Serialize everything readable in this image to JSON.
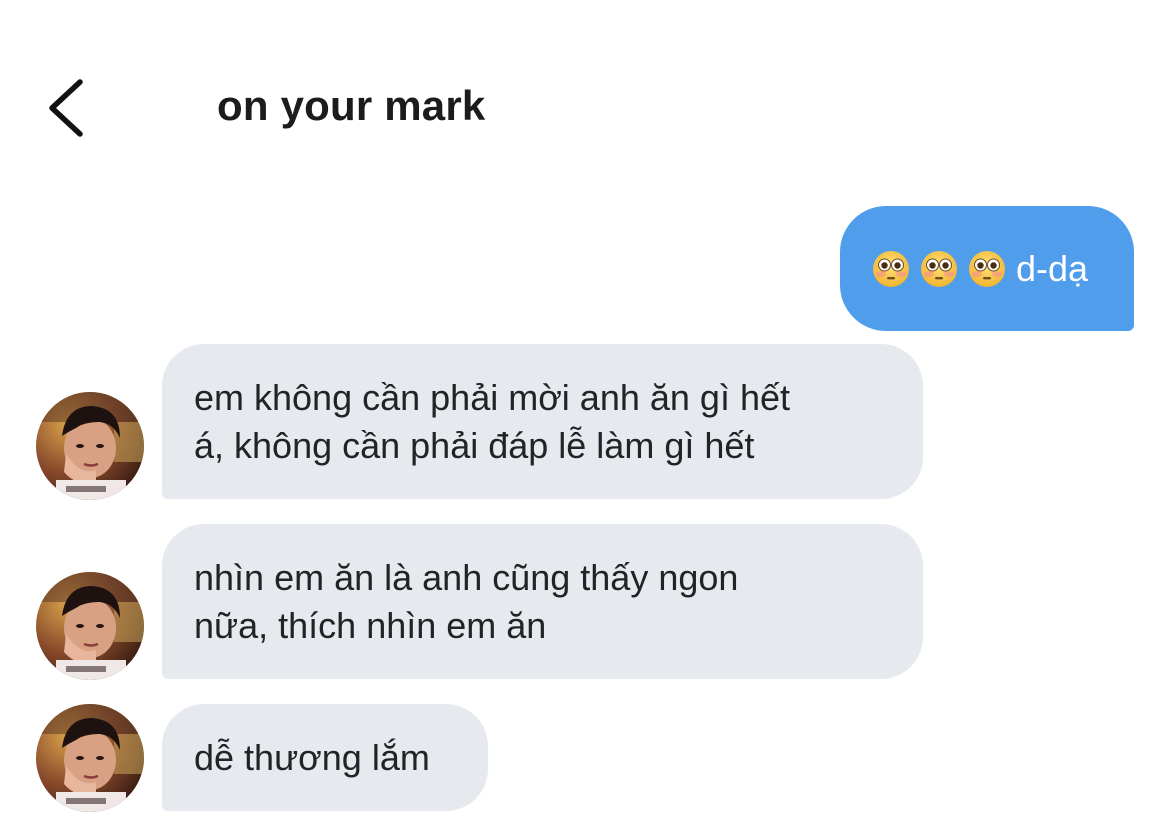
{
  "header": {
    "back_icon": "chevron-left-icon",
    "title": "on your mark"
  },
  "messages": [
    {
      "sender": "me",
      "emoji_icon": "flushed-face-emoji",
      "emoji_count": 3,
      "text": "d-dạ",
      "color": "#4f9deb"
    },
    {
      "sender": "other",
      "lines": [
        "em không cần phải mời anh ăn gì hết",
        "á, không cần phải đáp lễ làm gì hết"
      ]
    },
    {
      "sender": "other",
      "lines": [
        "nhìn em ăn là anh cũng thấy ngon",
        "nữa, thích nhìn em ăn"
      ]
    },
    {
      "sender": "other",
      "lines": [
        "dễ thương lắm"
      ]
    }
  ],
  "colors": {
    "outgoing_bubble": "#4f9deb",
    "incoming_bubble": "#e6e9ee"
  }
}
